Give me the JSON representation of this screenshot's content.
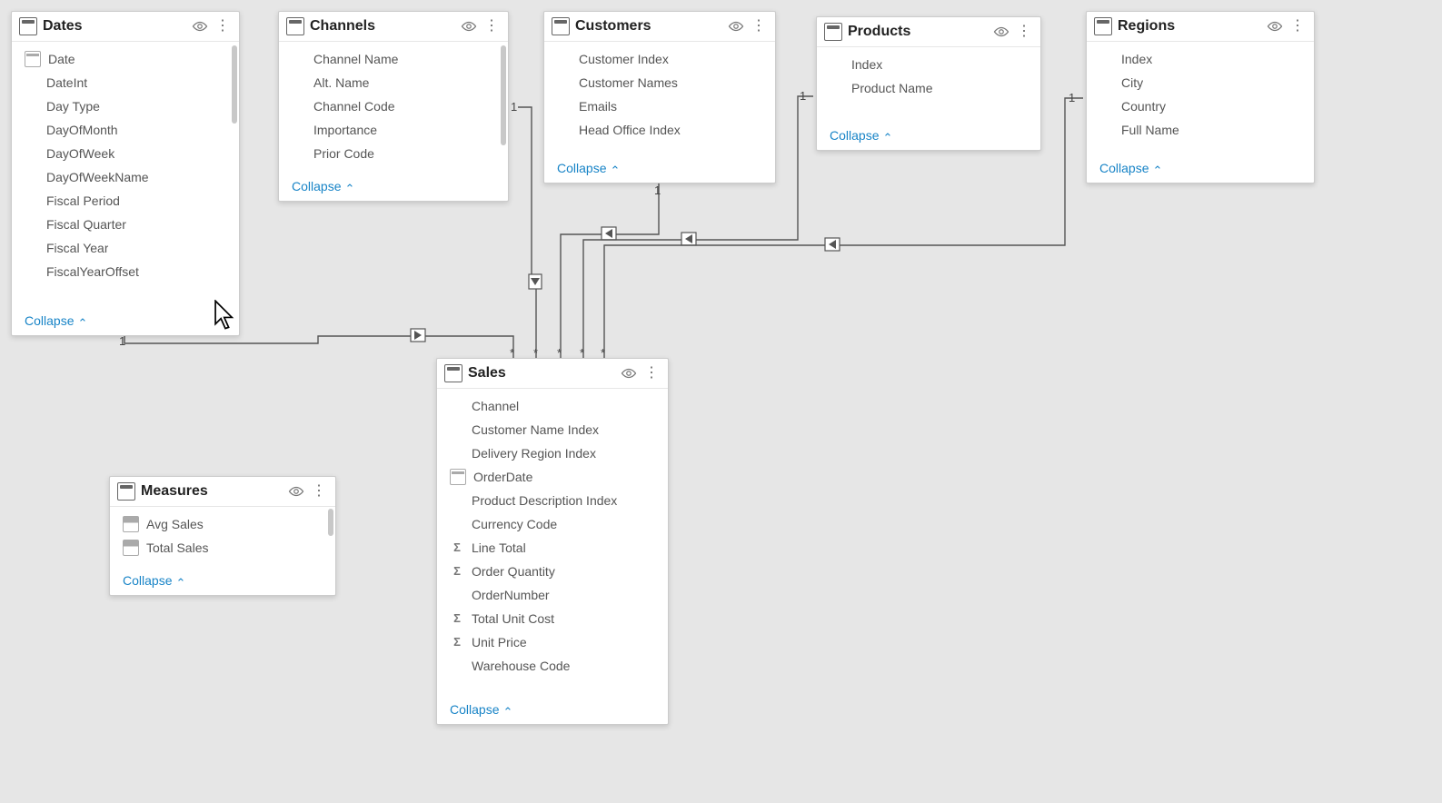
{
  "collapse_label": "Collapse",
  "tables": {
    "dates": {
      "title": "Dates",
      "fields": [
        {
          "label": "Date",
          "icon": "calendar"
        },
        {
          "label": "DateInt",
          "icon": "blank"
        },
        {
          "label": "Day Type",
          "icon": "blank"
        },
        {
          "label": "DayOfMonth",
          "icon": "blank"
        },
        {
          "label": "DayOfWeek",
          "icon": "blank"
        },
        {
          "label": "DayOfWeekName",
          "icon": "blank"
        },
        {
          "label": "Fiscal Period",
          "icon": "blank"
        },
        {
          "label": "Fiscal Quarter",
          "icon": "blank"
        },
        {
          "label": "Fiscal Year",
          "icon": "blank"
        },
        {
          "label": "FiscalYearOffset",
          "icon": "blank"
        }
      ]
    },
    "channels": {
      "title": "Channels",
      "fields": [
        {
          "label": "Channel Name",
          "icon": "blank"
        },
        {
          "label": "Alt. Name",
          "icon": "blank"
        },
        {
          "label": "Channel Code",
          "icon": "blank"
        },
        {
          "label": "Importance",
          "icon": "blank"
        },
        {
          "label": "Prior Code",
          "icon": "blank"
        }
      ]
    },
    "customers": {
      "title": "Customers",
      "fields": [
        {
          "label": "Customer Index",
          "icon": "blank"
        },
        {
          "label": "Customer Names",
          "icon": "blank"
        },
        {
          "label": "Emails",
          "icon": "blank"
        },
        {
          "label": "Head Office Index",
          "icon": "blank"
        }
      ]
    },
    "products": {
      "title": "Products",
      "fields": [
        {
          "label": "Index",
          "icon": "blank"
        },
        {
          "label": "Product Name",
          "icon": "blank"
        }
      ]
    },
    "regions": {
      "title": "Regions",
      "fields": [
        {
          "label": "Index",
          "icon": "blank"
        },
        {
          "label": "City",
          "icon": "blank"
        },
        {
          "label": "Country",
          "icon": "blank"
        },
        {
          "label": "Full Name",
          "icon": "blank"
        }
      ]
    },
    "sales": {
      "title": "Sales",
      "fields": [
        {
          "label": "Channel",
          "icon": "blank"
        },
        {
          "label": "Customer Name Index",
          "icon": "blank"
        },
        {
          "label": "Delivery Region Index",
          "icon": "blank"
        },
        {
          "label": "OrderDate",
          "icon": "calendar"
        },
        {
          "label": "Product Description Index",
          "icon": "blank"
        },
        {
          "label": "Currency Code",
          "icon": "blank"
        },
        {
          "label": "Line Total",
          "icon": "sigma"
        },
        {
          "label": "Order Quantity",
          "icon": "sigma"
        },
        {
          "label": "OrderNumber",
          "icon": "blank"
        },
        {
          "label": "Total Unit Cost",
          "icon": "sigma"
        },
        {
          "label": "Unit Price",
          "icon": "sigma"
        },
        {
          "label": "Warehouse Code",
          "icon": "blank"
        }
      ]
    },
    "measures": {
      "title": "Measures",
      "fields": [
        {
          "label": "Avg Sales",
          "icon": "calc"
        },
        {
          "label": "Total Sales",
          "icon": "calc"
        }
      ]
    }
  },
  "relationships": [
    {
      "from": "dates",
      "to": "sales",
      "from_card": "1",
      "to_card": "*"
    },
    {
      "from": "channels",
      "to": "sales",
      "from_card": "1",
      "to_card": "*"
    },
    {
      "from": "customers",
      "to": "sales",
      "from_card": "1",
      "to_card": "*"
    },
    {
      "from": "products",
      "to": "sales",
      "from_card": "1",
      "to_card": "*"
    },
    {
      "from": "regions",
      "to": "sales",
      "from_card": "1",
      "to_card": "*"
    }
  ]
}
